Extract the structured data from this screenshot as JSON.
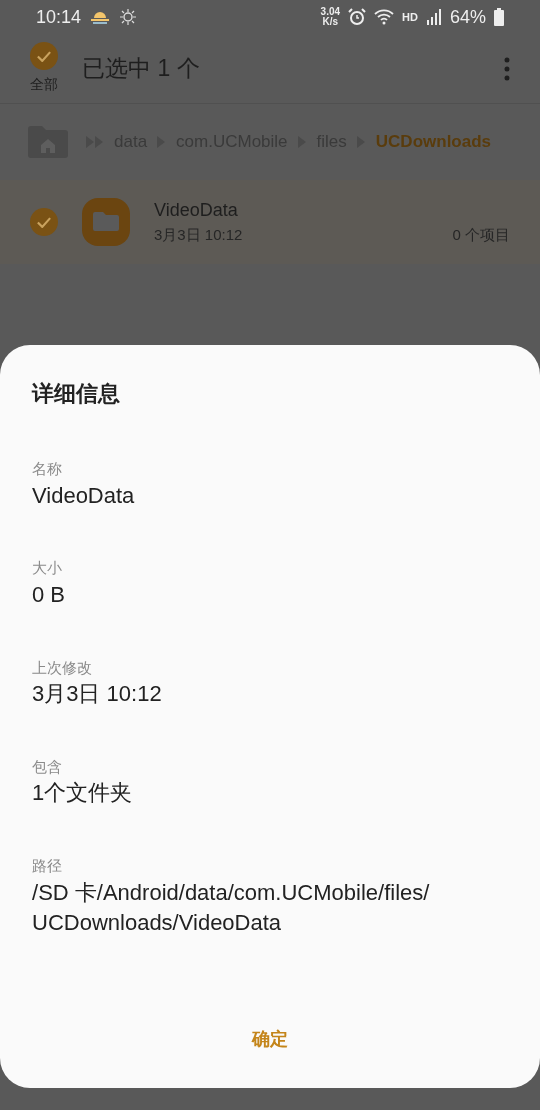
{
  "status_bar": {
    "time": "10:14",
    "speed": "3.04\nK/s",
    "network": "HD",
    "battery": "64%"
  },
  "header": {
    "select_all_label": "全部",
    "select_all_checked": true,
    "title": "已选中 1 个"
  },
  "breadcrumb": [
    {
      "label": "data",
      "selected": false
    },
    {
      "label": "com.UCMobile",
      "selected": false
    },
    {
      "label": "files",
      "selected": false
    },
    {
      "label": "UCDownloads",
      "selected": true
    }
  ],
  "files": [
    {
      "name": "VideoData",
      "date": "3月3日 10:12",
      "count": "0 个项目",
      "checked": true
    }
  ],
  "dialog": {
    "title": "详细信息",
    "fields": [
      {
        "label": "名称",
        "value": "VideoData"
      },
      {
        "label": "大小",
        "value": "0 B"
      },
      {
        "label": "上次修改",
        "value": "3月3日 10:12"
      },
      {
        "label": "包含",
        "value": "1个文件夹"
      },
      {
        "label": "路径",
        "value": "/SD 卡/Android/data/com.UCMobile/files/UCDownloads/VideoData"
      }
    ],
    "button": "确定"
  }
}
